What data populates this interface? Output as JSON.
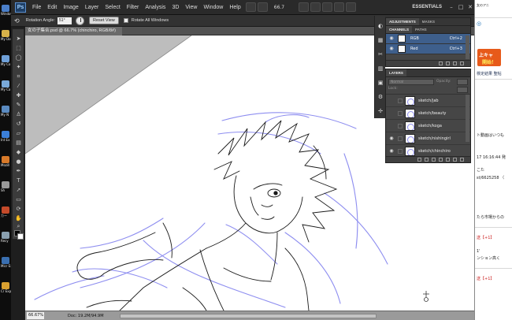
{
  "menubar": {
    "logo": "Ps",
    "items": [
      "File",
      "Edit",
      "Image",
      "Layer",
      "Select",
      "Filter",
      "Analysis",
      "3D",
      "View",
      "Window",
      "Help"
    ],
    "zoom": "66.7",
    "workspace": "ESSENTIALS",
    "win_controls": [
      "–",
      "□",
      "✕"
    ]
  },
  "options_bar": {
    "rotation_label": "Rotation Angle:",
    "rotation_value": "51°",
    "reset_button": "Reset View",
    "rotate_all_label": "Rotate All Windows"
  },
  "document": {
    "tab_title": "女の子集合.psd @ 66.7% (chinchiro, RGB/8#)",
    "zoom_status": "66.67%",
    "doc_info": "Doc: 19.2M/94.9M"
  },
  "adjustments_panel": {
    "tabs": [
      "ADJUSTMENTS",
      "MASKS"
    ]
  },
  "channels_panel": {
    "tabs": [
      "CHANNELS",
      "PATHS"
    ],
    "channels": [
      {
        "name": "RGB",
        "shortcut": "Ctrl+2"
      },
      {
        "name": "Red",
        "shortcut": "Ctrl+3"
      }
    ]
  },
  "layers_panel": {
    "title": "LAYERS",
    "blend_mode": "Normal",
    "opacity_label": "Opacity:",
    "lock_label": "Lock:",
    "layers": [
      {
        "name": "sketch/jab"
      },
      {
        "name": "sketch/beauty"
      },
      {
        "name": "sketch/koga"
      },
      {
        "name": "sketch/nishingirl"
      },
      {
        "name": "sketch/chinchiro"
      }
    ]
  },
  "desktop_icons": [
    {
      "label": "Windows Media",
      "color": "#4a7ec8"
    },
    {
      "label": "My Do",
      "color": "#d8b24a"
    },
    {
      "label": "My Co",
      "color": "#6fa0d8"
    },
    {
      "label": "My Ca",
      "color": "#7aa9d8"
    },
    {
      "label": "My N",
      "color": "#5a8ac0"
    },
    {
      "label": "Int Ex",
      "color": "#3b7fd9"
    },
    {
      "label": "Mozill",
      "color": "#d87a2a"
    },
    {
      "label": "Sh",
      "color": "#999999"
    },
    {
      "label": "カー",
      "color": "#c44a2a"
    },
    {
      "label": "Recy",
      "color": "#8aa0b0"
    },
    {
      "label": "Micr Exp",
      "color": "#3a6fb0"
    },
    {
      "label": "Cr Exp",
      "color": "#d9a030"
    }
  ],
  "browser": {
    "title_fragment": "女のアニ",
    "banner_line1": "上キャ",
    "banner_line2": "開始！",
    "lines": [
      {
        "text": "検定結果  聖帖",
        "tone": "blue"
      },
      {
        "text": "ト動画はいつも",
        "tone": "normal"
      },
      {
        "text": "17 16:16:44 発",
        "tone": "normal"
      },
      {
        "text": "こた",
        "tone": "normal"
      },
      {
        "text": "st/6625258 （",
        "tone": "normal"
      },
      {
        "text": "たら市場からの",
        "tone": "normal"
      },
      {
        "text": "送【+1】",
        "tone": "red"
      },
      {
        "text": "1'",
        "tone": "normal"
      },
      {
        "text": "ンション高く",
        "tone": "normal"
      },
      {
        "text": "送【+1】",
        "tone": "red"
      }
    ]
  },
  "colors": {
    "canvas": "#ffffff",
    "pasteboard": "#bdbdbd",
    "ink": "#1a1a1a",
    "sketch_blue": "#8e8ef0",
    "selection_blue": "#3e5f8c",
    "brand_blue": "#5b8fcf"
  }
}
